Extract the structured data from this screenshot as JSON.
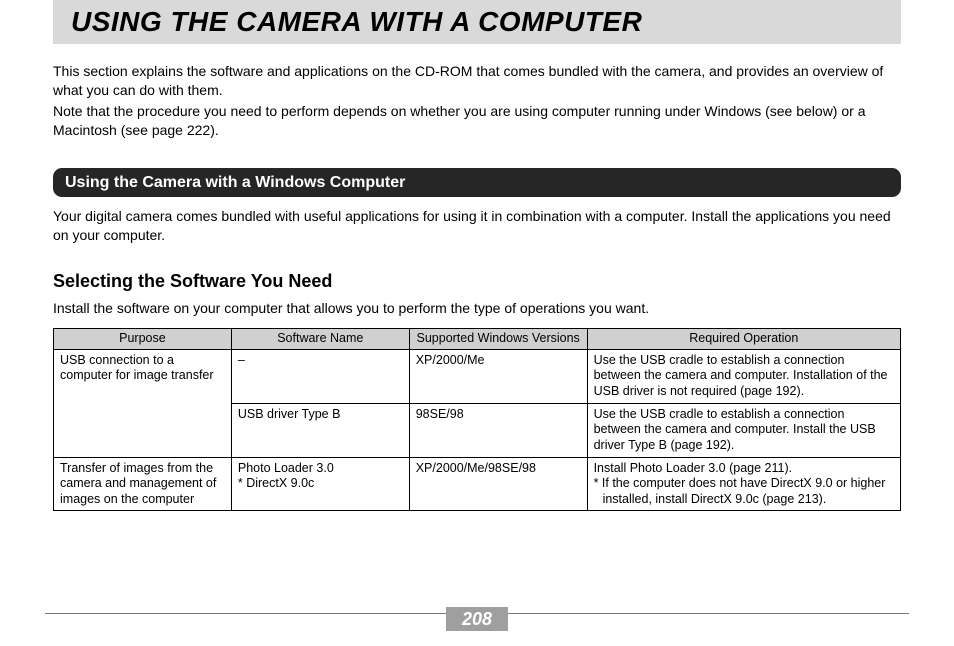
{
  "title": "USING THE CAMERA WITH A COMPUTER",
  "intro": {
    "p1": "This section explains the software and applications on the CD-ROM that comes bundled with the camera, and provides an overview of what you can do with them.",
    "p2": "Note that the procedure you need to perform depends on whether you are using computer running under Windows (see below) or a Macintosh (see page 222)."
  },
  "section": {
    "pill": "Using the Camera with a Windows Computer",
    "lead": "Your digital camera comes bundled with useful applications for using it in combination with a computer. Install the applications you need on your computer.",
    "subhead": "Selecting the Software You Need",
    "sublead": "Install the software on your computer that allows you to perform the type of operations you want."
  },
  "table": {
    "headers": {
      "purpose": "Purpose",
      "software": "Software Name",
      "versions": "Supported Windows Versions",
      "operation": "Required Operation"
    },
    "rows": {
      "r1": {
        "purpose": "USB connection to a computer for image transfer",
        "software": "–",
        "versions": "XP/2000/Me",
        "operation": "Use the USB cradle to establish a connection between the camera and computer. Installation of the USB driver is not required (page 192)."
      },
      "r2": {
        "software": "USB driver Type B",
        "versions": "98SE/98",
        "operation": "Use the USB cradle to establish a connection between the camera and computer. Install the USB driver Type B (page 192)."
      },
      "r3": {
        "purpose": "Transfer of images from the camera and management of images on the computer",
        "software_line1": "Photo Loader 3.0",
        "software_line2": "* DirectX 9.0c",
        "versions": "XP/2000/Me/98SE/98",
        "operation_line1": "Install Photo Loader 3.0 (page 211).",
        "operation_line2": "* If the computer does not have DirectX 9.0 or higher installed, install DirectX 9.0c (page 213)."
      }
    }
  },
  "page_number": "208"
}
